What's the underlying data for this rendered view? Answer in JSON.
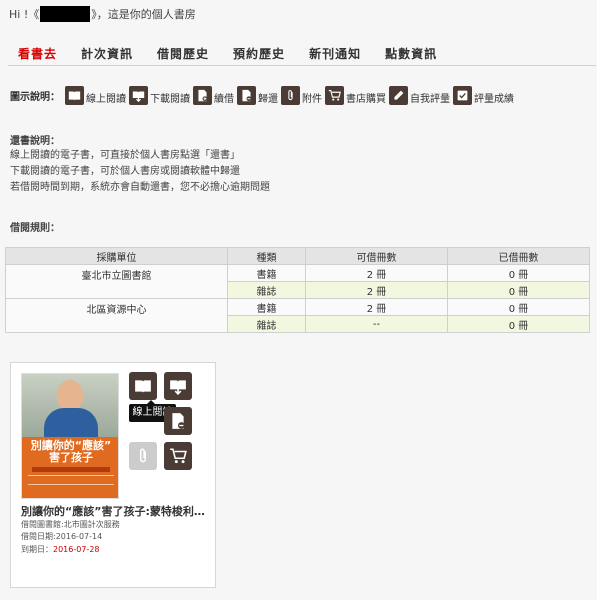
{
  "header": {
    "greeting_prefix": "Hi !《",
    "greeting_suffix": "》，這是你的個人書房"
  },
  "tabs": [
    {
      "label": "看書去",
      "active": true
    },
    {
      "label": "計次資訊",
      "active": false
    },
    {
      "label": "借閱歷史",
      "active": false
    },
    {
      "label": "預約歷史",
      "active": false
    },
    {
      "label": "新刊通知",
      "active": false
    },
    {
      "label": "點數資訊",
      "active": false
    }
  ],
  "legend": {
    "title": "圖示說明：",
    "items": [
      {
        "icon": "book-open-icon",
        "label": "線上閱讀"
      },
      {
        "icon": "download-icon",
        "label": "下載閱讀"
      },
      {
        "icon": "renew-icon",
        "label": "續借"
      },
      {
        "icon": "return-icon",
        "label": "歸還"
      },
      {
        "icon": "paperclip-icon",
        "label": "附件"
      },
      {
        "icon": "cart-icon",
        "label": "書店購買"
      },
      {
        "icon": "pencil-icon",
        "label": "自我評量"
      },
      {
        "icon": "score-icon",
        "label": "評量成績"
      }
    ]
  },
  "return_info": {
    "title": "還書說明：",
    "lines": [
      "線上閱讀的電子書，可直接於個人書房點選「還書」",
      "下載閱讀的電子書，可於個人書房或閱讀軟體中歸還",
      "若借閱時間到期，系統亦會自動還書，您不必擔心逾期問題"
    ]
  },
  "borrow_rules": {
    "title": "借閱規則：",
    "headers": [
      "採購單位",
      "種類",
      "可借冊數",
      "已借冊數"
    ],
    "units": [
      {
        "name": "臺北市立圖書館",
        "rows": [
          {
            "type": "書籍",
            "available": "2 冊",
            "borrowed": "0 冊"
          },
          {
            "type": "雜誌",
            "available": "2 冊",
            "borrowed": "0 冊"
          }
        ]
      },
      {
        "name": "北區資源中心",
        "rows": [
          {
            "type": "書籍",
            "available": "2 冊",
            "borrowed": "0 冊"
          },
          {
            "type": "雜誌",
            "available": "--",
            "borrowed": "0 冊"
          }
        ]
      }
    ]
  },
  "book": {
    "cover_title_line1": "別讓你的“應該”",
    "cover_title_line2": "害了孩子",
    "title": "別讓你的“應該”害了孩子:蒙特梭利教養",
    "library": "借閱圖書館:北市圖計次服務",
    "borrow_date": "借閱日期:2016-07-14",
    "due_label": "到期日：",
    "due_date": "2016-07-28",
    "tooltip": "線上閱讀"
  },
  "colors": {
    "active_tab": "#d60000",
    "icon_bg": "#4a3b35",
    "due_date": "#cc0000",
    "magazine_row": "#f2f8e0"
  }
}
